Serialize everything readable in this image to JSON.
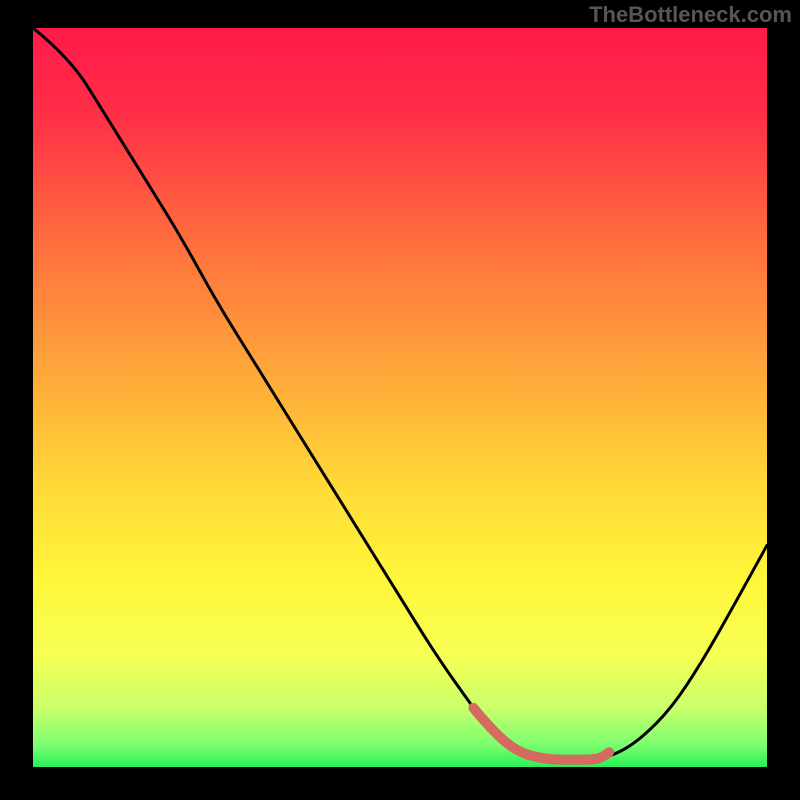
{
  "watermark": "TheBottleneck.com",
  "chart_data": {
    "type": "line",
    "title": "",
    "xlabel": "",
    "ylabel": "",
    "xlim": [
      0,
      100
    ],
    "ylim": [
      0,
      100
    ],
    "grid": false,
    "series": [
      {
        "name": "bottleneck-curve",
        "x": [
          0,
          5,
          10,
          15,
          20,
          25,
          30,
          35,
          40,
          45,
          50,
          55,
          60,
          63,
          66,
          70,
          74,
          77,
          80,
          83,
          87,
          91,
          95,
          100
        ],
        "values": [
          100,
          96,
          88,
          80,
          72,
          63,
          55,
          47,
          39,
          31,
          23,
          15,
          8,
          4,
          2,
          1,
          1,
          1,
          2,
          4,
          8,
          14,
          21,
          30
        ]
      }
    ],
    "highlight_segment": {
      "name": "valley-highlight",
      "x": [
        60,
        62.5,
        66,
        70,
        74,
        77,
        78.5
      ],
      "values": [
        8,
        5,
        2,
        1,
        1,
        1,
        2
      ],
      "color": "#d46a60"
    },
    "gradient_stops": [
      {
        "offset": 0.0,
        "color": "#ff1a4a"
      },
      {
        "offset": 0.12,
        "color": "#ff2f47"
      },
      {
        "offset": 0.28,
        "color": "#ff6b3e"
      },
      {
        "offset": 0.45,
        "color": "#ffa23a"
      },
      {
        "offset": 0.62,
        "color": "#ffd938"
      },
      {
        "offset": 0.75,
        "color": "#fff73a"
      },
      {
        "offset": 0.85,
        "color": "#f6ff55"
      },
      {
        "offset": 0.92,
        "color": "#c9ff6a"
      },
      {
        "offset": 0.97,
        "color": "#7cff70"
      },
      {
        "offset": 1.0,
        "color": "#2aee5a"
      }
    ]
  }
}
